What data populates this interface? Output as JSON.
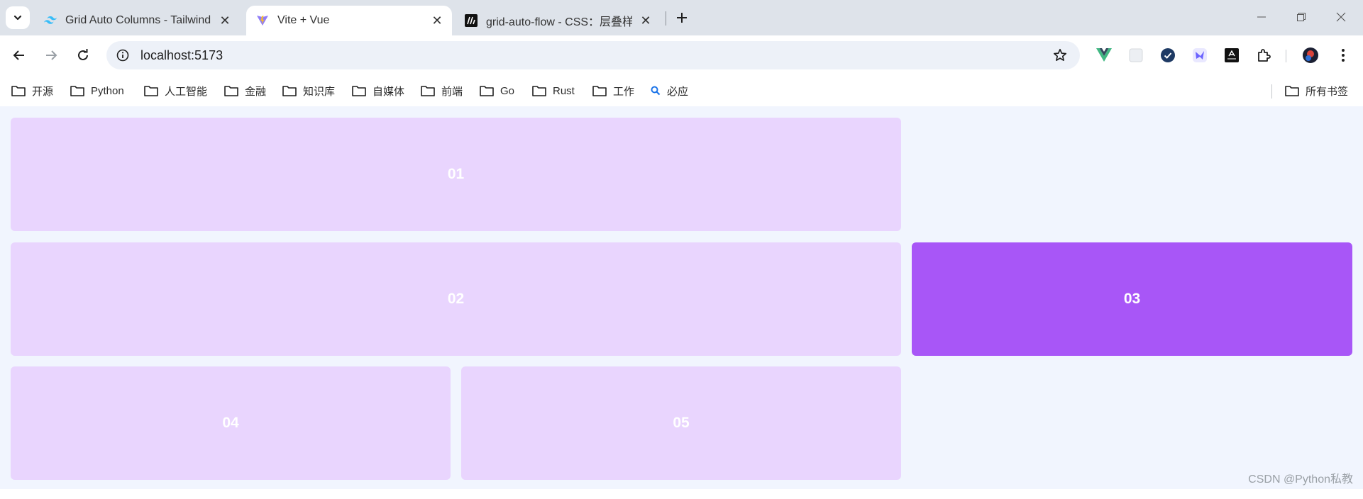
{
  "tabs": [
    {
      "title": "Grid Auto Columns - Tailwind",
      "favicon": "tailwind-icon"
    },
    {
      "title": "Vite + Vue",
      "favicon": "vite-icon"
    },
    {
      "title": "grid-auto-flow - CSS：层叠样",
      "favicon": "mdn-icon"
    }
  ],
  "address": {
    "url": "localhost:5173"
  },
  "bookmarks": [
    {
      "label": "开源",
      "icon": "folder-icon"
    },
    {
      "label": "Python",
      "icon": "folder-icon"
    },
    {
      "label": "人工智能",
      "icon": "folder-icon"
    },
    {
      "label": "金融",
      "icon": "folder-icon"
    },
    {
      "label": "知识库",
      "icon": "folder-icon"
    },
    {
      "label": "自媒体",
      "icon": "folder-icon"
    },
    {
      "label": "前端",
      "icon": "folder-icon"
    },
    {
      "label": "Go",
      "icon": "folder-icon"
    },
    {
      "label": "Rust",
      "icon": "folder-icon"
    },
    {
      "label": "工作",
      "icon": "folder-icon"
    },
    {
      "label": "必应",
      "icon": "search-icon"
    }
  ],
  "all_bookmarks": {
    "label": "所有书签"
  },
  "grid": {
    "items": [
      {
        "label": "01"
      },
      {
        "label": "02"
      },
      {
        "label": "03"
      },
      {
        "label": "04"
      },
      {
        "label": "05"
      }
    ]
  },
  "colors": {
    "light": "#e9d5fe",
    "dark": "#a856f7",
    "background": "#f1f5fe"
  },
  "watermark": "CSDN @Python私教"
}
